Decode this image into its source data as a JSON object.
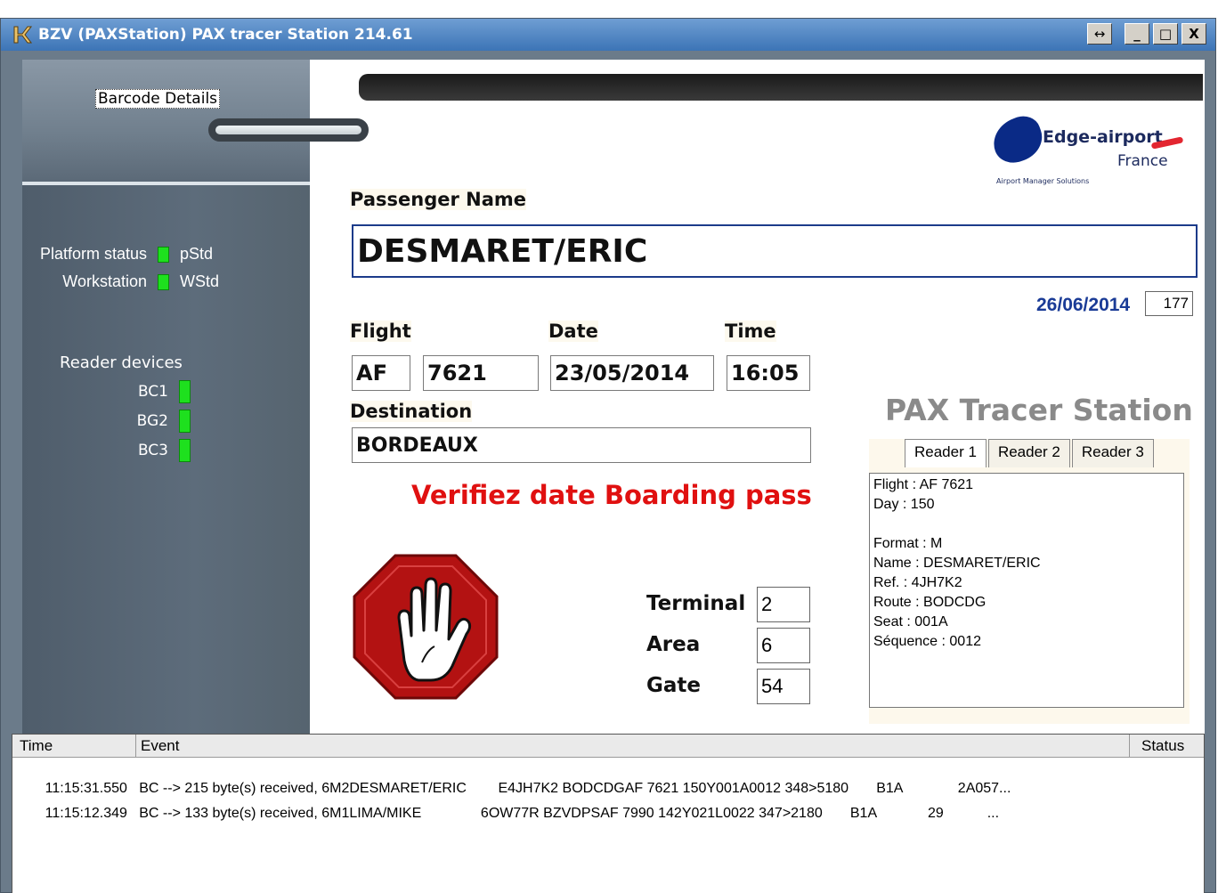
{
  "window": {
    "title": "BZV  (PAXStation) PAX tracer Station 214.61",
    "resize_label": "↔",
    "minimize_label": "_",
    "maximize_label": "□",
    "close_label": "X"
  },
  "sidebar": {
    "barcode_label": "Barcode Details",
    "platform_status_label": "Platform status",
    "platform_status_code": "pStd",
    "workstation_label": "Workstation",
    "workstation_code": "WStd",
    "readers_title": "Reader devices",
    "readers": [
      "BC1",
      "BG2",
      "BC3"
    ]
  },
  "logo": {
    "brand": "Edge-airport",
    "country": "France",
    "tagline": "Airport Manager Solutions"
  },
  "passenger": {
    "label": "Passenger Name",
    "name": "DESMARET/ERIC"
  },
  "header_date": "26/06/2014",
  "counter": "177",
  "flight": {
    "flight_label": "Flight",
    "date_label": "Date",
    "time_label": "Time",
    "carrier": "AF",
    "number": "7621",
    "date": "23/05/2014",
    "time": "16:05",
    "destination_label": "Destination",
    "destination": "BORDEAUX"
  },
  "warning": "Verifiez date Boarding pass",
  "location": {
    "terminal_label": "Terminal",
    "terminal": "2",
    "area_label": "Area",
    "area": "6",
    "gate_label": "Gate",
    "gate": "54"
  },
  "station_title": "PAX Tracer Station",
  "reader_tabs": [
    "Reader 1",
    "Reader 2",
    "Reader 3"
  ],
  "reader_details": {
    "flight": "Flight : AF 7621",
    "day": "Day : 150",
    "format": "Format : M",
    "name": "Name : DESMARET/ERIC",
    "ref": "Ref. : 4JH7K2",
    "route": "Route : BODCDG",
    "seat": "Seat : 001A",
    "sequence": "Séquence : 0012"
  },
  "log": {
    "columns": [
      "Time",
      "Event",
      "Status"
    ],
    "rows": [
      {
        "time": "11:15:31.550",
        "event": "BC --> 215 byte(s) received, 6M2DESMARET/ERIC        E4JH7K2 BODCDGAF 7621 150Y001A0012 348>5180       B1A              2A057..."
      },
      {
        "time": "11:15:12.349",
        "event": "BC --> 133 byte(s) received, 6M1LIMA/MIKE               6OW77R BZVDPSAF 7990 142Y021L0022 347>2180       B1A             29           ..."
      }
    ]
  },
  "colors": {
    "led_green": "#1ee01e",
    "warning_red": "#e01010",
    "date_blue": "#1a3b96",
    "stop_red": "#b31212"
  }
}
